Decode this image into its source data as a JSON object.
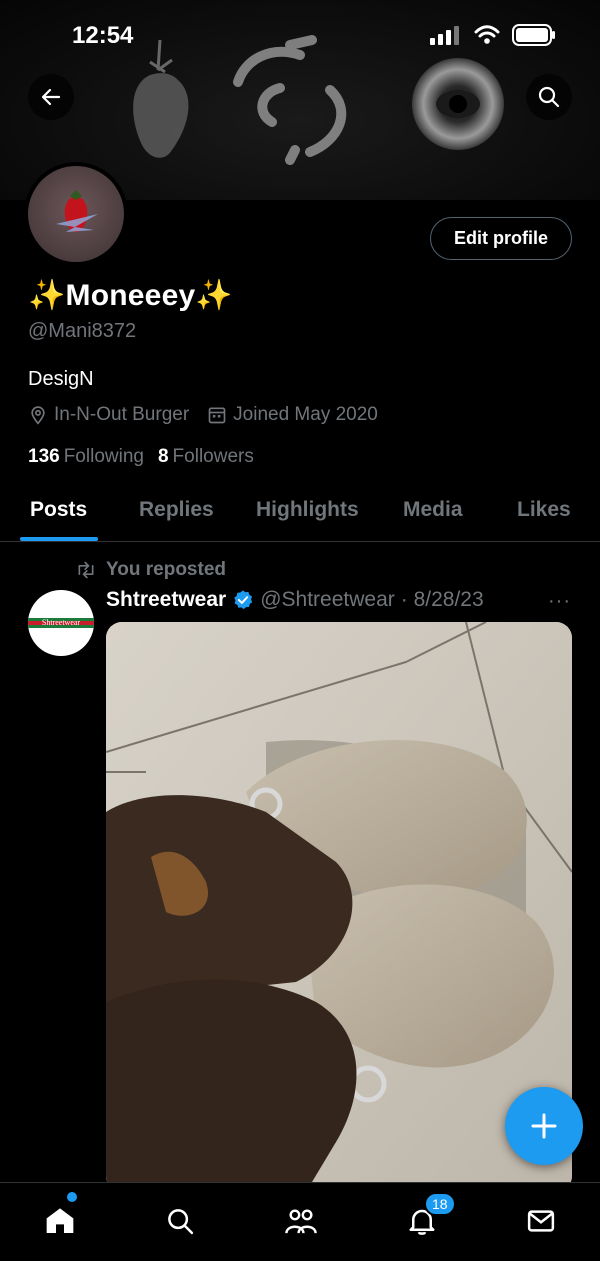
{
  "status_bar": {
    "time": "12:54"
  },
  "profile": {
    "display_name": "✨Moneeey✨",
    "handle": "@Mani8372",
    "bio": "DesigN",
    "location": "In-N-Out Burger",
    "joined": "Joined May 2020",
    "following_count": "136",
    "following_label": "Following",
    "followers_count": "8",
    "followers_label": "Followers",
    "edit_label": "Edit profile"
  },
  "tabs": [
    {
      "label": "Posts",
      "active": true
    },
    {
      "label": "Replies"
    },
    {
      "label": "Highlights"
    },
    {
      "label": "Media"
    },
    {
      "label": "Likes"
    }
  ],
  "post": {
    "repost_label": "You reposted",
    "author_name": "Shtreetwear",
    "author_handle": "@Shtreetwear",
    "date": "· 8/28/23",
    "more": "···",
    "avatar_text": "Shtreetwear"
  },
  "nav": {
    "notifications_badge": "18",
    "icons": [
      "home-icon",
      "search-icon",
      "communities-icon",
      "bell-icon",
      "mail-icon"
    ]
  },
  "colors": {
    "accent": "#1d9bf0",
    "muted": "#71767b",
    "border": "#2f3336"
  }
}
